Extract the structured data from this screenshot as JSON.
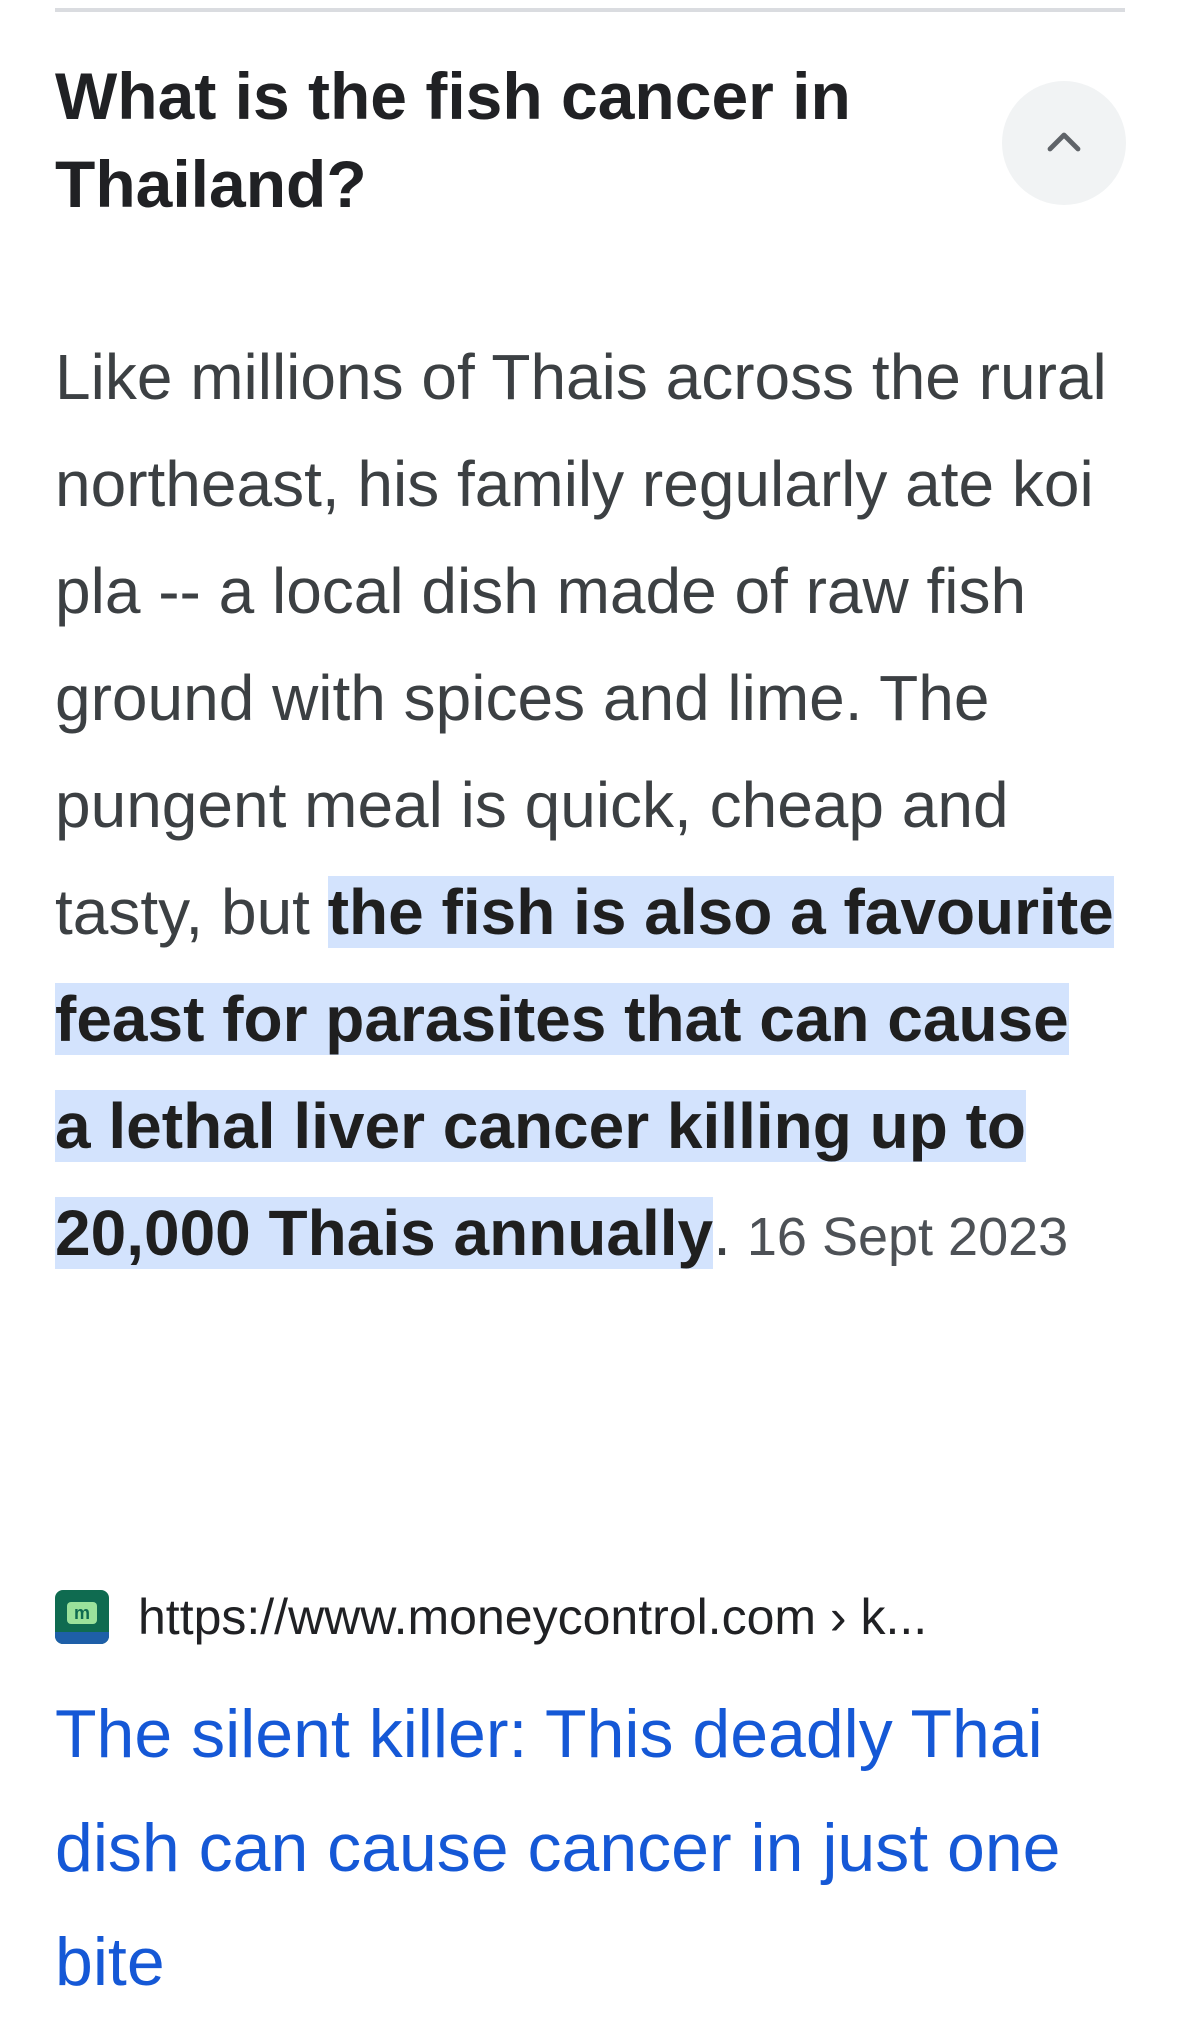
{
  "faq": {
    "question": "What is the fish cancer in Thailand?",
    "collapse_icon": "chevron-up-icon",
    "answer": {
      "text_plain": "Like millions of Thais across the rural northeast, his family regularly ate koi pla -- a local dish made of raw fish ground with spices and lime. The pungent meal is quick, cheap and tasty, but ",
      "text_highlight": "the fish is also a favourite feast for parasites that can cause a lethal liver cancer killing up to 20,000 Thais annually",
      "text_end": ".",
      "date": "16 Sept 2023"
    }
  },
  "source": {
    "favicon_letter": "m",
    "url": "https://www.moneycontrol.com › k..."
  },
  "result": {
    "title": "The silent killer: This deadly Thai dish can cause cancer in just one bite"
  },
  "colors": {
    "highlight_bg": "#d3e3fd",
    "link": "#1558d6",
    "text": "#3c4043"
  }
}
